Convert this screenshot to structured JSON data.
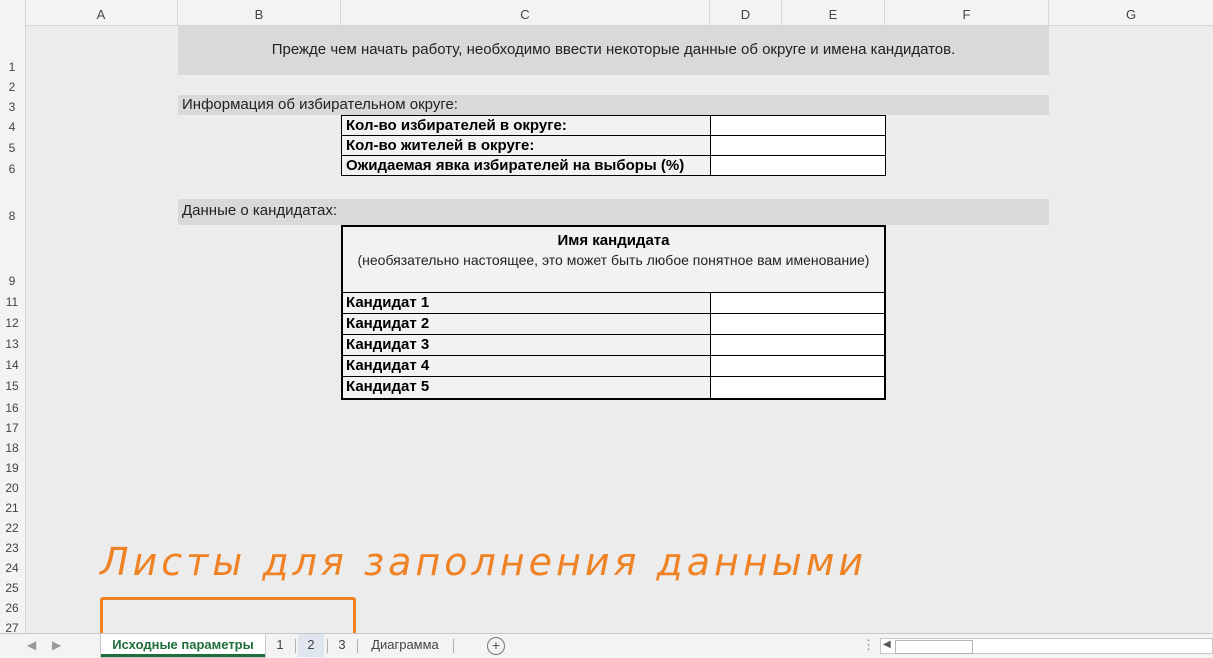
{
  "columns": [
    "A",
    "B",
    "C",
    "D",
    "E",
    "F",
    "G"
  ],
  "rows": [
    "1",
    "2",
    "3",
    "4",
    "5",
    "6",
    "8",
    "9",
    "11",
    "12",
    "13",
    "14",
    "15",
    "16",
    "17",
    "18",
    "19",
    "20",
    "21",
    "22",
    "23",
    "24",
    "25",
    "26",
    "27"
  ],
  "banner": "Прежде чем начать работу,  необходимо ввести некоторые данные об округе и имена кандидатов.",
  "district": {
    "section_label": "Информация об избирательном округе:",
    "fields": [
      {
        "label": "Кол-во избирателей в округе:",
        "value": ""
      },
      {
        "label": "Кол-во жителей в округе:",
        "value": ""
      },
      {
        "label": "Ожидаемая явка избирателей на выборы (%)",
        "value": ""
      }
    ]
  },
  "candidates": {
    "section_label": "Данные о кандидатах:",
    "header_title": "Имя кандидата",
    "header_sub": "(необязательно настоящее, это может быть любое понятное вам именование)",
    "items": [
      {
        "label": "Кандидат 1",
        "value": ""
      },
      {
        "label": "Кандидат 2",
        "value": ""
      },
      {
        "label": "Кандидат 3",
        "value": ""
      },
      {
        "label": "Кандидат 4",
        "value": ""
      },
      {
        "label": "Кандидат 5",
        "value": ""
      }
    ]
  },
  "annotation": "Листы для заполнения данными",
  "tabs": [
    {
      "label": "Исходные параметры",
      "state": "active"
    },
    {
      "label": "1",
      "state": "normal"
    },
    {
      "label": "2",
      "state": "selected"
    },
    {
      "label": "3",
      "state": "normal"
    },
    {
      "label": "Диаграмма",
      "state": "normal"
    }
  ],
  "accent_color": "#f08226",
  "tab_active_color": "#1e6f3c"
}
